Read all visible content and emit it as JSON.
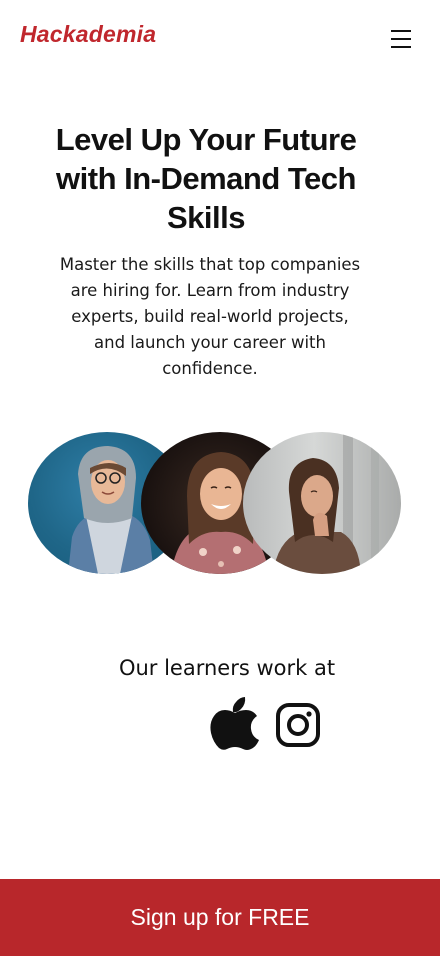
{
  "header": {
    "logo_text": "Hackademia",
    "menu_icon": "hamburger-menu-icon"
  },
  "hero": {
    "title": "Level Up Your Future with In-Demand Tech Skills",
    "description": "Master the skills that top companies are hiring for. Learn from industry experts, build real-world projects, and launch your career with confidence."
  },
  "learners": {
    "heading": "Our learners work at",
    "companies": [
      "apple-logo",
      "instagram-logo"
    ]
  },
  "cta": {
    "label": "Sign up for FREE"
  },
  "colors": {
    "brand": "#c0272d",
    "cta_background": "#b8272b",
    "text": "#111111",
    "background": "#ffffff"
  }
}
